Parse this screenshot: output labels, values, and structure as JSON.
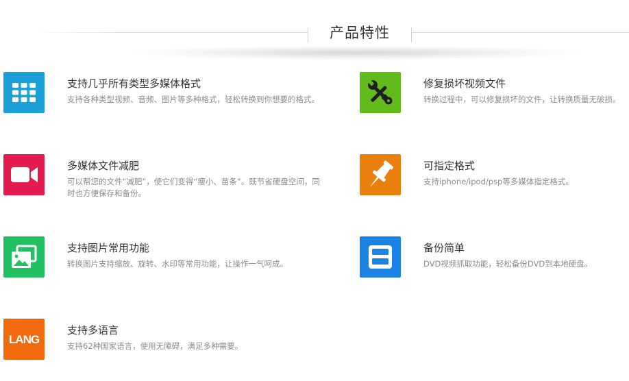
{
  "header": {
    "title": "产品特性"
  },
  "features": [
    {
      "title": "支持几乎所有类型多媒体格式",
      "desc": "支持各种类型视频、音频、图片等多种格式，轻松转换到你想要的格式。",
      "icon": "grid-icon",
      "color": "#1ba1d8"
    },
    {
      "title": "修复损坏视频文件",
      "desc": "转换过程中，可以修复损坏的文件，让转换质量无破损。",
      "icon": "tools-icon",
      "color": "#62ba1b"
    },
    {
      "title": "多媒体文件减肥",
      "desc": "可以帮您的文件“减肥”，使它们变得“瘦小、苗条”。既节省硬盘空间，同时也方便保存和备份。",
      "icon": "video-camera-icon",
      "color": "#e41b4e"
    },
    {
      "title": "可指定格式",
      "desc": "支持iphone/ipod/psp等多媒体指定格式。",
      "icon": "pushpin-icon",
      "color": "#e9800e"
    },
    {
      "title": "支持图片常用功能",
      "desc": "转换图片支持缩放、旋转、水印等常用功能，让操作一气呵成。",
      "icon": "pictures-icon",
      "color": "#21c162"
    },
    {
      "title": "备份简单",
      "desc": "DVD视频抓取功能，轻松备份DVD到本地硬盘。",
      "icon": "save-icon",
      "color": "#1a82e2"
    },
    {
      "title": "支持多语言",
      "desc": "支持62种国家语言，使用无障碍，满足多种需要。",
      "icon": "lang-icon",
      "icon_text": "LANG",
      "color": "#f16b0e"
    }
  ]
}
